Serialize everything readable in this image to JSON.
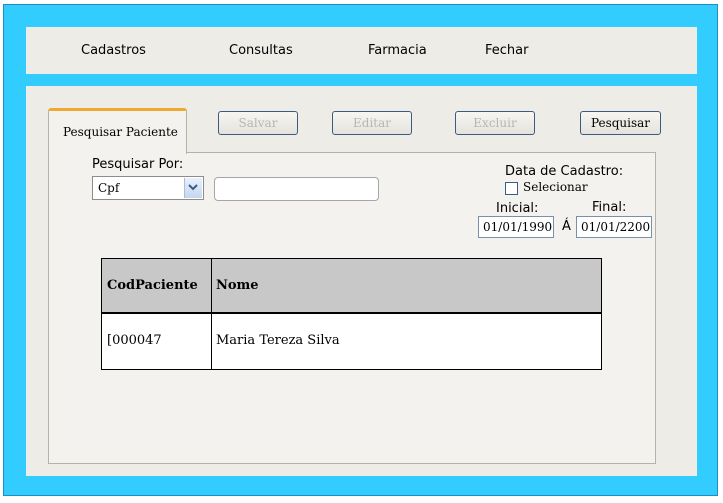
{
  "menu": {
    "cadastros": "Cadastros",
    "consultas": "Consultas",
    "farmacia": "Farmacia",
    "fechar": "Fechar"
  },
  "tab": {
    "label": "Pesquisar Paciente"
  },
  "toolbar": {
    "salvar": "Salvar",
    "editar": "Editar",
    "excluir": "Excluir",
    "pesquisar": "Pesquisar"
  },
  "search": {
    "label": "Pesquisar Por:",
    "selected": "Cpf",
    "value": ""
  },
  "date_filter": {
    "title": "Data de Cadastro:",
    "checkbox_label": "Selecionar",
    "initial_label": "Inicial:",
    "final_label": "Final:",
    "separator": "Á",
    "initial_value": "01/01/1990",
    "final_value": "01/01/2200"
  },
  "table": {
    "headers": [
      "CodPaciente",
      "Nome"
    ],
    "rows": [
      [
        "[000047",
        "Maria Tereza Silva"
      ]
    ]
  },
  "colors": {
    "frame": "#33ccff",
    "panel": "#eeece6",
    "tab_accent": "#f0a830",
    "header_row": "#c8c8c8"
  }
}
